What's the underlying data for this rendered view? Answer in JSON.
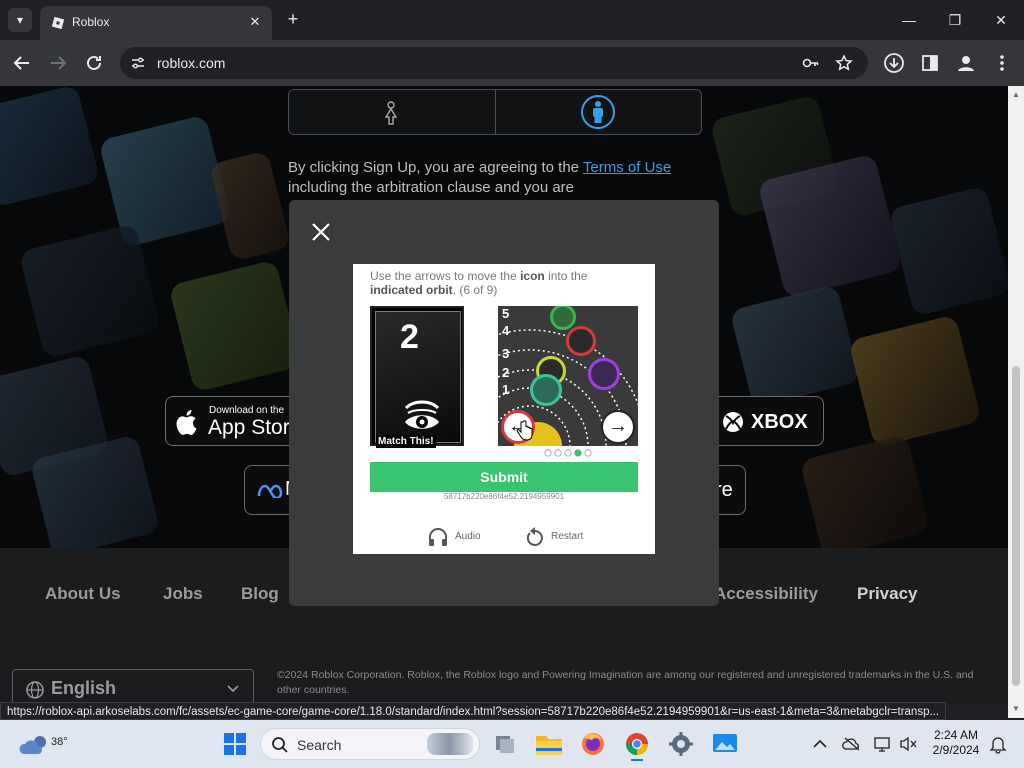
{
  "browser": {
    "tab_title": "Roblox",
    "url": "roblox.com",
    "status_url": "https://roblox-api.arkoselabs.com/fc/assets/ec-game-core/game-core/1.18.0/standard/index.html?session=58717b220e86f4e52.2194959901&r=us-east-1&meta=3&metabgclr=transp..."
  },
  "page": {
    "legal_prefix": "By clicking Sign Up, you are agreeing to the ",
    "legal_link": "Terms of Use",
    "legal_suffix": " including the arbitration clause and you are",
    "badges": {
      "app_store_small": "Download on the",
      "app_store": "App Store",
      "xbox": "XBOX",
      "meta_partial": "M",
      "store_partial": "re"
    },
    "footer_links": [
      "About Us",
      "Jobs",
      "Blog",
      "Accessibility",
      "Privacy"
    ],
    "language": "English",
    "copyright": "©2024 Roblox Corporation. Roblox, the Roblox logo and Powering Imagination are among our registered and unregistered trademarks in the U.S. and other countries."
  },
  "captcha": {
    "instr_1": "Use the arrows to move the ",
    "instr_icon": "icon",
    "instr_2": " into the",
    "instr_orbit": "indicated orbit",
    "instr_progress": ". (6 of 9)",
    "target_number": "2",
    "match_label": "Match This!",
    "orbit_labels": [
      "5",
      "4",
      "3",
      "2",
      "1"
    ],
    "submit_label": "Submit",
    "session_id": "58717b220e86f4e52.2194959901",
    "audio_label": "Audio",
    "restart_label": "Restart",
    "current_step": 4,
    "total_steps": 5
  },
  "taskbar": {
    "temperature": "38°",
    "search_label": "Search",
    "time": "2:24 AM",
    "date": "2/9/2024"
  }
}
